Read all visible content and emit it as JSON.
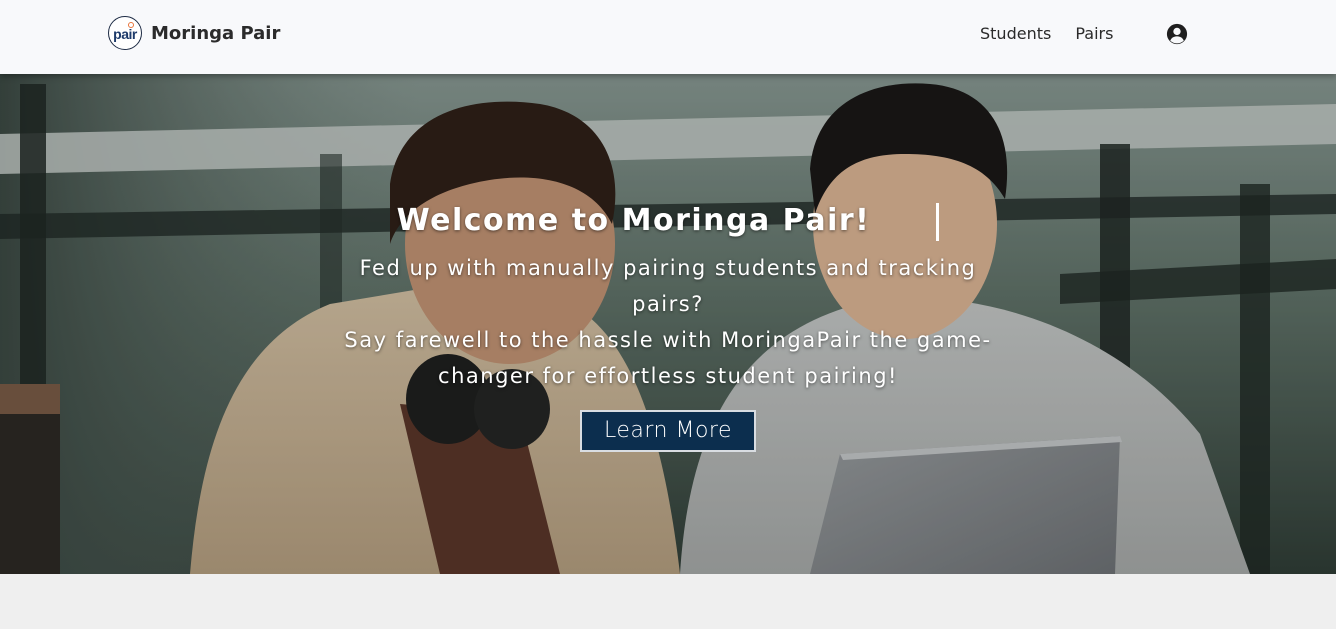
{
  "brand": {
    "logo_text": "pair",
    "name": "Moringa Pair"
  },
  "nav": {
    "links": [
      {
        "label": "Students"
      },
      {
        "label": "Pairs"
      }
    ],
    "profile_icon": "user-circle-icon"
  },
  "hero": {
    "title": "Welcome to Moringa Pair!",
    "subtitle_line1": "Fed up with manually pairing students and tracking pairs?",
    "subtitle_line2": "Say farewell to the hassle with MoringaPair the game-changer for effortless student pairing!",
    "cta_label": "Learn More",
    "cta_color": "#0c2e4e"
  }
}
